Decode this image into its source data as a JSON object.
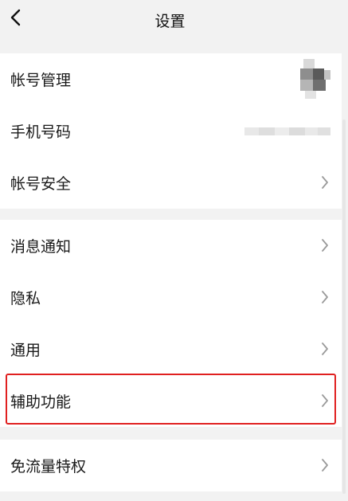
{
  "header": {
    "title": "设置",
    "back_icon": "chevron-left-icon"
  },
  "groups": [
    {
      "items": [
        {
          "label": "帐号管理",
          "trailing": "avatar"
        },
        {
          "label": "手机号码",
          "trailing": "masked-phone"
        },
        {
          "label": "帐号安全",
          "trailing": "chevron-right-icon"
        }
      ]
    },
    {
      "items": [
        {
          "label": "消息通知",
          "trailing": "chevron-right-icon"
        },
        {
          "label": "隐私",
          "trailing": "chevron-right-icon"
        },
        {
          "label": "通用",
          "trailing": "chevron-right-icon"
        },
        {
          "label": "辅助功能",
          "trailing": "chevron-right-icon",
          "highlighted": true
        }
      ]
    },
    {
      "items": [
        {
          "label": "免流量特权",
          "trailing": "chevron-right-icon"
        }
      ]
    }
  ],
  "colors": {
    "background": "#f2f2f2",
    "card": "#ffffff",
    "highlight_border": "#e02020",
    "chevron": "#9a9a9a"
  }
}
